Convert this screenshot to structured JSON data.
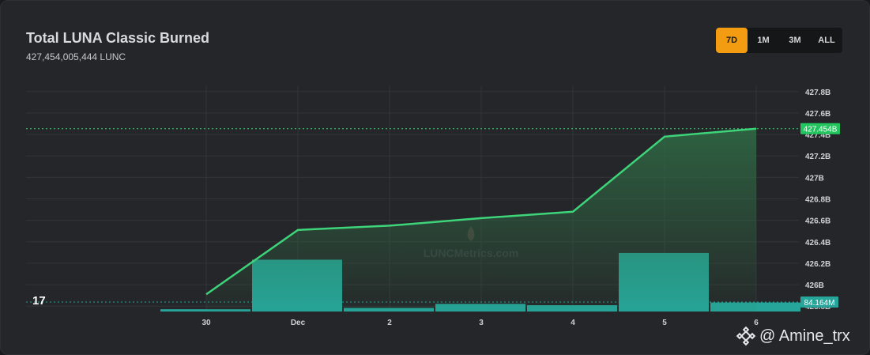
{
  "header": {
    "title": "Total LUNA Classic Burned",
    "subtitle": "427,454,005,444 LUNC"
  },
  "range_buttons": [
    {
      "label": "7D",
      "active": true
    },
    {
      "label": "1M",
      "active": false
    },
    {
      "label": "3M",
      "active": false
    },
    {
      "label": "ALL",
      "active": false
    }
  ],
  "watermark": {
    "chart_logo": "LUNCMetrics.com",
    "tv_logo": "TradingView-icon",
    "user": "@ Amine_trx"
  },
  "colors": {
    "line": "#3dd47a",
    "area": "#2f6b45",
    "bars": "#26a69a",
    "price_tag": "#22c55e",
    "bar_tag": "#26a69a",
    "active_button": "#f39c12"
  },
  "chart_data": {
    "type": "line",
    "x": [
      "30",
      "Dec",
      "2",
      "3",
      "4",
      "5",
      "6"
    ],
    "series": [
      {
        "values": [
          425.91,
          426.51,
          426.55,
          426.62,
          426.68,
          427.38,
          427.454
        ]
      }
    ],
    "bars": {
      "values": [
        5,
        115,
        8,
        17,
        14,
        130,
        20
      ]
    },
    "y_ticks": [
      "427.8B",
      "427.6B",
      "427.4B",
      "427.2B",
      "427B",
      "426.8B",
      "426.6B",
      "426.4B",
      "426.2B",
      "426B",
      "425.8B"
    ],
    "ylim": [
      425.75,
      427.85
    ],
    "last_value_label": "427.454B",
    "last_bar_label": "84.164M",
    "grid": true
  }
}
